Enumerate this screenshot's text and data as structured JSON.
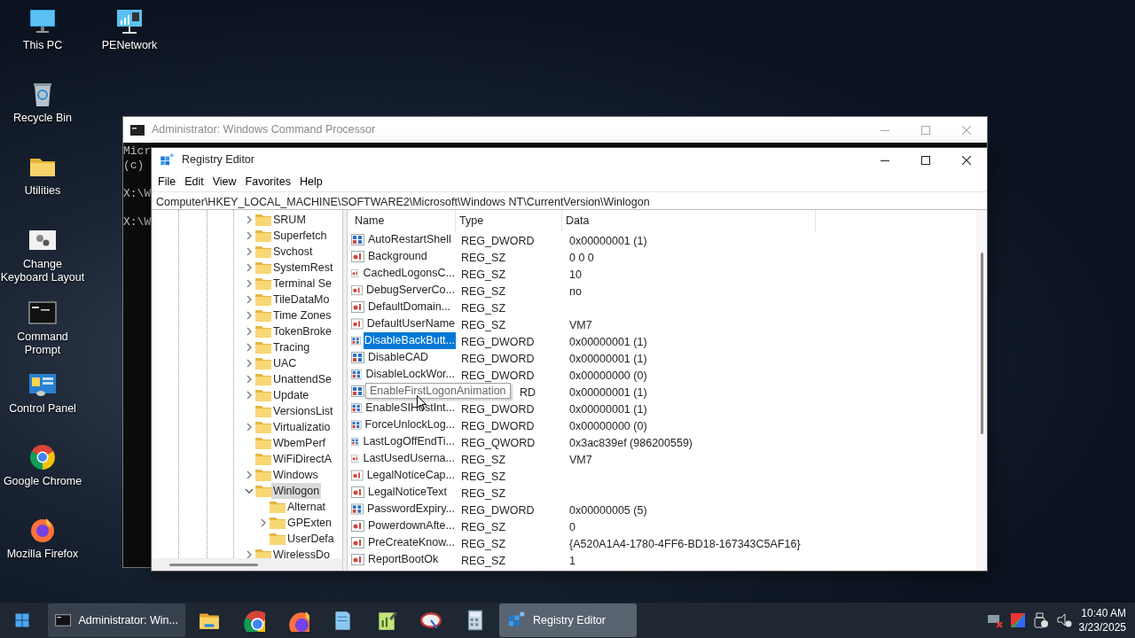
{
  "desktop_icons": [
    {
      "label": "This PC",
      "kind": "pc"
    },
    {
      "label": "PENetwork",
      "kind": "network"
    },
    {
      "label": "Recycle Bin",
      "kind": "recycle"
    },
    {
      "label": "Utilities",
      "kind": "folder"
    },
    {
      "label": "Change Keyboard Layout",
      "kind": "keyboard"
    },
    {
      "label": "Command Prompt",
      "kind": "console"
    },
    {
      "label": "Control Panel",
      "kind": "control"
    },
    {
      "label": "Google Chrome",
      "kind": "chrome"
    },
    {
      "label": "Mozilla Firefox",
      "kind": "firefox"
    }
  ],
  "cmd_window": {
    "title": "Administrator: Windows Command Processor",
    "paragraphs": [
      [
        "Micr",
        "(c)"
      ],
      [
        "X:\\W"
      ],
      [
        "X:\\W"
      ]
    ]
  },
  "regedit": {
    "title": "Registry Editor",
    "menu": [
      "File",
      "Edit",
      "View",
      "Favorites",
      "Help"
    ],
    "address": "Computer\\HKEY_LOCAL_MACHINE\\SOFTWARE2\\Microsoft\\Windows NT\\CurrentVersion\\Winlogon",
    "tree": [
      {
        "label": "SRUM",
        "has_subkeys": true,
        "expanded": false,
        "selected": false
      },
      {
        "label": "Superfetch",
        "has_subkeys": true,
        "expanded": false,
        "selected": false
      },
      {
        "label": "Svchost",
        "has_subkeys": true,
        "expanded": false,
        "selected": false
      },
      {
        "label": "SystemRest",
        "has_subkeys": true,
        "expanded": false,
        "selected": false
      },
      {
        "label": "Terminal Se",
        "has_subkeys": true,
        "expanded": false,
        "selected": false
      },
      {
        "label": "TileDataMo",
        "has_subkeys": true,
        "expanded": false,
        "selected": false
      },
      {
        "label": "Time Zones",
        "has_subkeys": true,
        "expanded": false,
        "selected": false
      },
      {
        "label": "TokenBroke",
        "has_subkeys": true,
        "expanded": false,
        "selected": false
      },
      {
        "label": "Tracing",
        "has_subkeys": true,
        "expanded": false,
        "selected": false
      },
      {
        "label": "UAC",
        "has_subkeys": true,
        "expanded": false,
        "selected": false
      },
      {
        "label": "UnattendSe",
        "has_subkeys": true,
        "expanded": false,
        "selected": false
      },
      {
        "label": "Update",
        "has_subkeys": true,
        "expanded": false,
        "selected": false
      },
      {
        "label": "VersionsList",
        "has_subkeys": false,
        "selected": false
      },
      {
        "label": "Virtualizatio",
        "has_subkeys": true,
        "expanded": false,
        "selected": false
      },
      {
        "label": "WbemPerf",
        "has_subkeys": false,
        "selected": false
      },
      {
        "label": "WiFiDirectA",
        "has_subkeys": false,
        "selected": false
      },
      {
        "label": "Windows",
        "has_subkeys": true,
        "expanded": false,
        "selected": false
      },
      {
        "label": "Winlogon",
        "has_subkeys": true,
        "expanded": true,
        "selected": true,
        "children": [
          {
            "label": "Alternat",
            "has_subkeys": false,
            "selected": false
          },
          {
            "label": "GPExten",
            "has_subkeys": true,
            "expanded": false,
            "selected": false
          },
          {
            "label": "UserDefa",
            "has_subkeys": false,
            "selected": false
          }
        ]
      },
      {
        "label": "WirelessDo",
        "has_subkeys": true,
        "expanded": false,
        "selected": false
      }
    ],
    "columns": [
      "Name",
      "Type",
      "Data"
    ],
    "rows": [
      {
        "name": "AutoRestartShell",
        "type": "REG_DWORD",
        "data": "0x00000001 (1)",
        "kind": "binary",
        "selected": false
      },
      {
        "name": "Background",
        "type": "REG_SZ",
        "data": "0 0 0",
        "kind": "string",
        "selected": false
      },
      {
        "name": "CachedLogonsC...",
        "type": "REG_SZ",
        "data": "10",
        "kind": "string",
        "selected": false
      },
      {
        "name": "DebugServerCo...",
        "type": "REG_SZ",
        "data": "no",
        "kind": "string",
        "selected": false
      },
      {
        "name": "DefaultDomain...",
        "type": "REG_SZ",
        "kind": "string",
        "selected": false
      },
      {
        "name": "DefaultUserName",
        "type": "REG_SZ",
        "data": "VM7",
        "kind": "string",
        "selected": false
      },
      {
        "name": "DisableBackButt...",
        "type": "REG_DWORD",
        "data": "0x00000001 (1)",
        "kind": "binary",
        "selected": true
      },
      {
        "name": "DisableCAD",
        "type": "REG_DWORD",
        "data": "0x00000001 (1)",
        "kind": "binary",
        "selected": false
      },
      {
        "name": "DisableLockWor...",
        "type": "REG_DWORD",
        "data": "0x00000000 (0)",
        "kind": "binary",
        "selected": false
      },
      {
        "tooltip": "EnableFirstLogonAnimation",
        "type": "RD",
        "data": "0x00000001 (1)",
        "kind": "binary",
        "selected": false
      },
      {
        "name": "EnableSIHostInt...",
        "type": "REG_DWORD",
        "data": "0x00000001 (1)",
        "kind": "binary",
        "selected": false
      },
      {
        "name": "ForceUnlockLog...",
        "type": "REG_DWORD",
        "data": "0x00000000 (0)",
        "kind": "binary",
        "selected": false
      },
      {
        "name": "LastLogOffEndTi...",
        "type": "REG_QWORD",
        "data": "0x3ac839ef (986200559)",
        "kind": "binary",
        "selected": false
      },
      {
        "name": "LastUsedUserna...",
        "type": "REG_SZ",
        "data": "VM7",
        "kind": "string",
        "selected": false
      },
      {
        "name": "LegalNoticeCap...",
        "type": "REG_SZ",
        "kind": "string",
        "selected": false
      },
      {
        "name": "LegalNoticeText",
        "type": "REG_SZ",
        "kind": "string",
        "selected": false
      },
      {
        "name": "PasswordExpiry...",
        "type": "REG_DWORD",
        "data": "0x00000005 (5)",
        "kind": "binary",
        "selected": false
      },
      {
        "name": "PowerdownAfte...",
        "type": "REG_SZ",
        "data": "0",
        "kind": "string",
        "selected": false
      },
      {
        "name": "PreCreateKnow...",
        "type": "REG_SZ",
        "data": "{A520A1A4-1780-4FF6-BD18-167343C5AF16}",
        "kind": "string",
        "selected": false
      },
      {
        "name": "ReportBootOk",
        "type": "REG_SZ",
        "data": "1",
        "kind": "string",
        "selected": false
      }
    ]
  },
  "taskbar": {
    "items": [
      {
        "kind": "start",
        "selected": false
      },
      {
        "kind": "window",
        "label": "Administrator: Win...",
        "selected": false
      },
      {
        "kind": "pinned",
        "selected": false
      },
      {
        "kind": "pinned",
        "selected": false
      },
      {
        "kind": "pinned",
        "selected": false
      },
      {
        "kind": "pinned",
        "selected": false
      },
      {
        "kind": "pinned",
        "selected": false
      },
      {
        "kind": "pinned",
        "selected": false
      },
      {
        "kind": "pinned",
        "selected": false
      },
      {
        "kind": "window",
        "label": "Registry Editor",
        "selected": true
      }
    ],
    "time": "10:40 AM",
    "date": "3/23/2025"
  }
}
